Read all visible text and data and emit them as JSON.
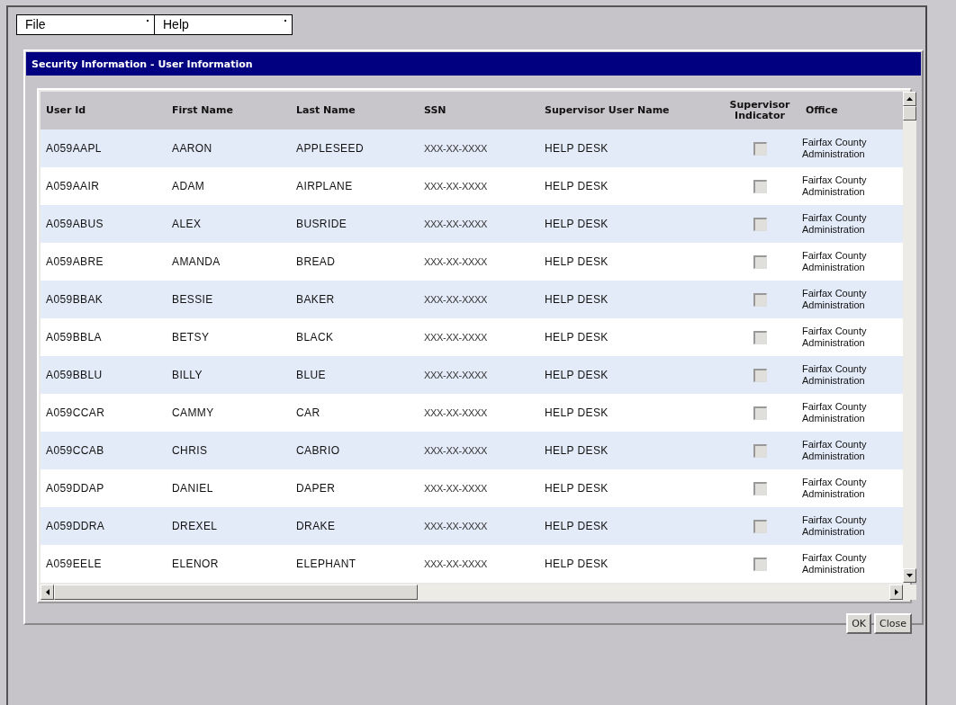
{
  "menus": [
    {
      "label": "File"
    },
    {
      "label": "Help"
    }
  ],
  "dialog": {
    "title": "Security Information - User Information"
  },
  "table": {
    "columns": [
      "User Id",
      "First Name",
      "Last Name",
      "SSN",
      "Supervisor User Name",
      "Supervisor Indicator",
      "Office"
    ],
    "rows": [
      {
        "user_id": "A059AAPL",
        "first_name": "AARON",
        "last_name": "APPLESEED",
        "ssn": "XXX-XX-XXXX",
        "supervisor": "HELP DESK",
        "checked": false,
        "office": "Fairfax County Administration"
      },
      {
        "user_id": "A059AAIR",
        "first_name": "ADAM",
        "last_name": "AIRPLANE",
        "ssn": "XXX-XX-XXXX",
        "supervisor": "HELP DESK",
        "checked": false,
        "office": "Fairfax County Administration"
      },
      {
        "user_id": "A059ABUS",
        "first_name": "ALEX",
        "last_name": "BUSRIDE",
        "ssn": "XXX-XX-XXXX",
        "supervisor": "HELP DESK",
        "checked": false,
        "office": "Fairfax County Administration"
      },
      {
        "user_id": "A059ABRE",
        "first_name": "AMANDA",
        "last_name": "BREAD",
        "ssn": "XXX-XX-XXXX",
        "supervisor": "HELP DESK",
        "checked": false,
        "office": "Fairfax County Administration"
      },
      {
        "user_id": "A059BBAK",
        "first_name": "BESSIE",
        "last_name": "BAKER",
        "ssn": "XXX-XX-XXXX",
        "supervisor": "HELP DESK",
        "checked": false,
        "office": "Fairfax County Administration"
      },
      {
        "user_id": "A059BBLA",
        "first_name": "BETSY",
        "last_name": "BLACK",
        "ssn": "XXX-XX-XXXX",
        "supervisor": "HELP DESK",
        "checked": false,
        "office": "Fairfax County Administration"
      },
      {
        "user_id": "A059BBLU",
        "first_name": "BILLY",
        "last_name": "BLUE",
        "ssn": "XXX-XX-XXXX",
        "supervisor": "HELP DESK",
        "checked": false,
        "office": "Fairfax County Administration"
      },
      {
        "user_id": "A059CCAR",
        "first_name": "CAMMY",
        "last_name": "CAR",
        "ssn": "XXX-XX-XXXX",
        "supervisor": "HELP DESK",
        "checked": false,
        "office": "Fairfax County Administration"
      },
      {
        "user_id": "A059CCAB",
        "first_name": "CHRIS",
        "last_name": "CABRIO",
        "ssn": "XXX-XX-XXXX",
        "supervisor": "HELP DESK",
        "checked": false,
        "office": "Fairfax County Administration"
      },
      {
        "user_id": "A059DDAP",
        "first_name": "DANIEL",
        "last_name": "DAPER",
        "ssn": "XXX-XX-XXXX",
        "supervisor": "HELP DESK",
        "checked": false,
        "office": "Fairfax County Administration"
      },
      {
        "user_id": "A059DDRA",
        "first_name": "DREXEL",
        "last_name": "DRAKE",
        "ssn": "XXX-XX-XXXX",
        "supervisor": "HELP DESK",
        "checked": false,
        "office": "Fairfax County Administration"
      },
      {
        "user_id": "A059EELE",
        "first_name": "ELENOR",
        "last_name": "ELEPHANT",
        "ssn": "XXX-XX-XXXX",
        "supervisor": "HELP DESK",
        "checked": false,
        "office": "Fairfax County Administration"
      }
    ]
  },
  "buttons": [
    "OK",
    "Close"
  ]
}
